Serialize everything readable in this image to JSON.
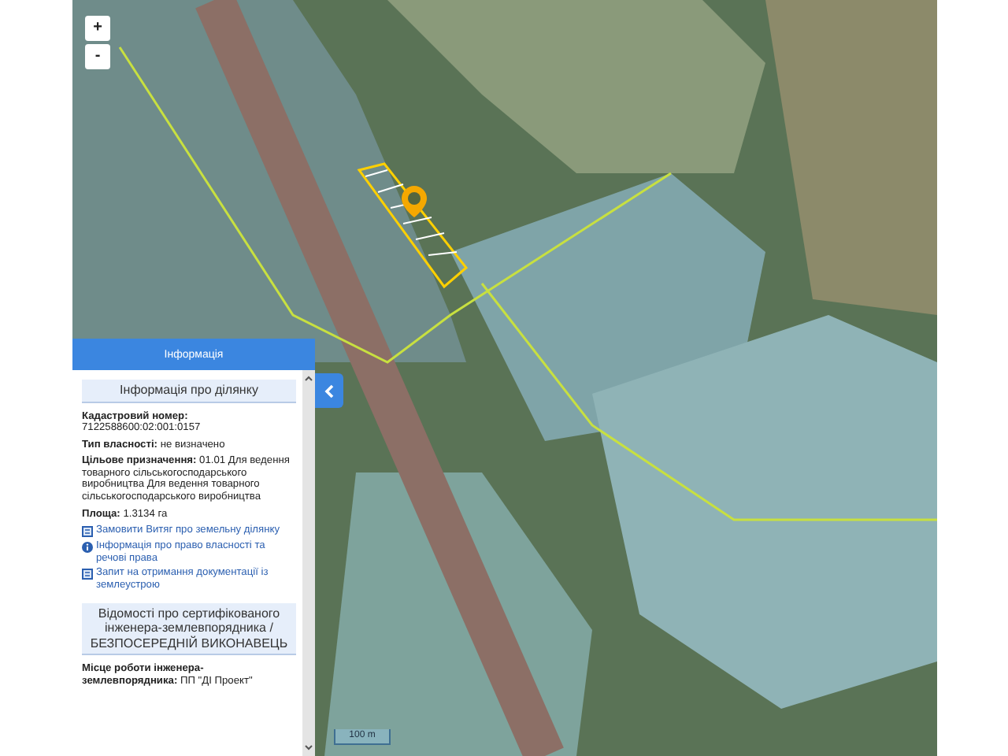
{
  "map": {
    "zoom_in": "+",
    "zoom_out": "-",
    "scale": "100 m"
  },
  "panel": {
    "title": "Інформація",
    "sections": [
      {
        "title": "Інформація про ділянку",
        "fields": [
          {
            "label": "Кадастровий номер:",
            "value": "7122588600:02:001:0157"
          },
          {
            "label": "Тип власності:",
            "value": "не визначено"
          },
          {
            "label": "Цільове призначення:",
            "value": "01.01 Для ведення товарного сільськогосподарського виробництва Для ведення товарного сільськогосподарського виробництва"
          },
          {
            "label": "Площа:",
            "value": "1.3134 га"
          }
        ],
        "links": [
          {
            "kind": "document",
            "text": "Замовити Витяг про земельну ділянку"
          },
          {
            "kind": "info",
            "text": "Інформація про право власності та речові права"
          },
          {
            "kind": "document",
            "text": "Запит на отримання документації із землеустрою"
          }
        ]
      },
      {
        "title": "Відомості про сертифікованого інженера-землевпорядника / БЕЗПОСЕРЕДНІЙ ВИКОНАВЕЦЬ",
        "fields": [
          {
            "label": "Місце роботи інженера-землевпорядника:",
            "value": "ПП \"ДІ Проект\""
          }
        ]
      }
    ]
  }
}
